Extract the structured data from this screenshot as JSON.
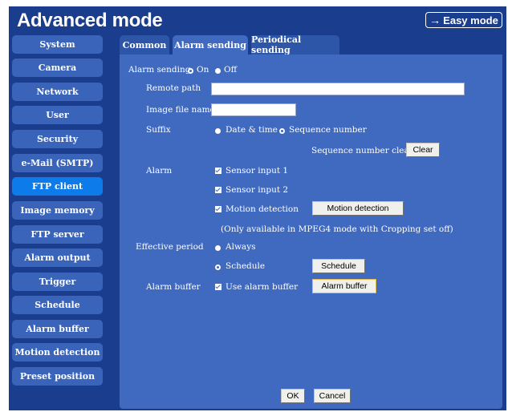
{
  "header": {
    "title": "Advanced mode",
    "easy_mode_label": "Easy mode"
  },
  "sidebar": {
    "items": [
      {
        "label": "System",
        "active": false
      },
      {
        "label": "Camera",
        "active": false
      },
      {
        "label": "Network",
        "active": false
      },
      {
        "label": "User",
        "active": false
      },
      {
        "label": "Security",
        "active": false
      },
      {
        "label": "e-Mail (SMTP)",
        "active": false
      },
      {
        "label": "FTP client",
        "active": true
      },
      {
        "label": "Image memory",
        "active": false
      },
      {
        "label": "FTP server",
        "active": false
      },
      {
        "label": "Alarm output",
        "active": false
      },
      {
        "label": "Trigger",
        "active": false
      },
      {
        "label": "Schedule",
        "active": false
      },
      {
        "label": "Alarm buffer",
        "active": false
      },
      {
        "label": "Motion detection",
        "active": false
      },
      {
        "label": "Preset position",
        "active": false
      }
    ]
  },
  "tabs": [
    {
      "label": "Common",
      "active": false
    },
    {
      "label": "Alarm sending",
      "active": true
    },
    {
      "label": "Periodical sending",
      "active": false
    }
  ],
  "form": {
    "alarm_sending": {
      "label": "Alarm sending",
      "on_label": "On",
      "off_label": "Off",
      "value": "On"
    },
    "remote_path": {
      "label": "Remote path",
      "value": ""
    },
    "image_file_name": {
      "label": "Image file name",
      "value": ""
    },
    "suffix": {
      "label": "Suffix",
      "date_time_label": "Date & time",
      "sequence_label": "Sequence number",
      "value": "Sequence number"
    },
    "sequence_clear": {
      "label": "Sequence number clear",
      "button": "Clear"
    },
    "alarm": {
      "label": "Alarm",
      "sensor1": "Sensor input 1",
      "sensor2": "Sensor input 2",
      "motion": "Motion detection",
      "motion_button": "Motion detection",
      "note": "(Only available in MPEG4 mode with Cropping set off)"
    },
    "effective_period": {
      "label": "Effective period",
      "always_label": "Always",
      "schedule_label": "Schedule",
      "schedule_button": "Schedule",
      "value": "Schedule"
    },
    "alarm_buffer": {
      "label": "Alarm buffer",
      "use_label": "Use alarm buffer",
      "button": "Alarm buffer"
    }
  },
  "footer": {
    "ok": "OK",
    "cancel": "Cancel"
  },
  "colors": {
    "frame": "#1b3d8d",
    "panel": "#3f6ac0",
    "sidebar_item": "#3a64ba",
    "sidebar_active": "#0d7bea"
  }
}
